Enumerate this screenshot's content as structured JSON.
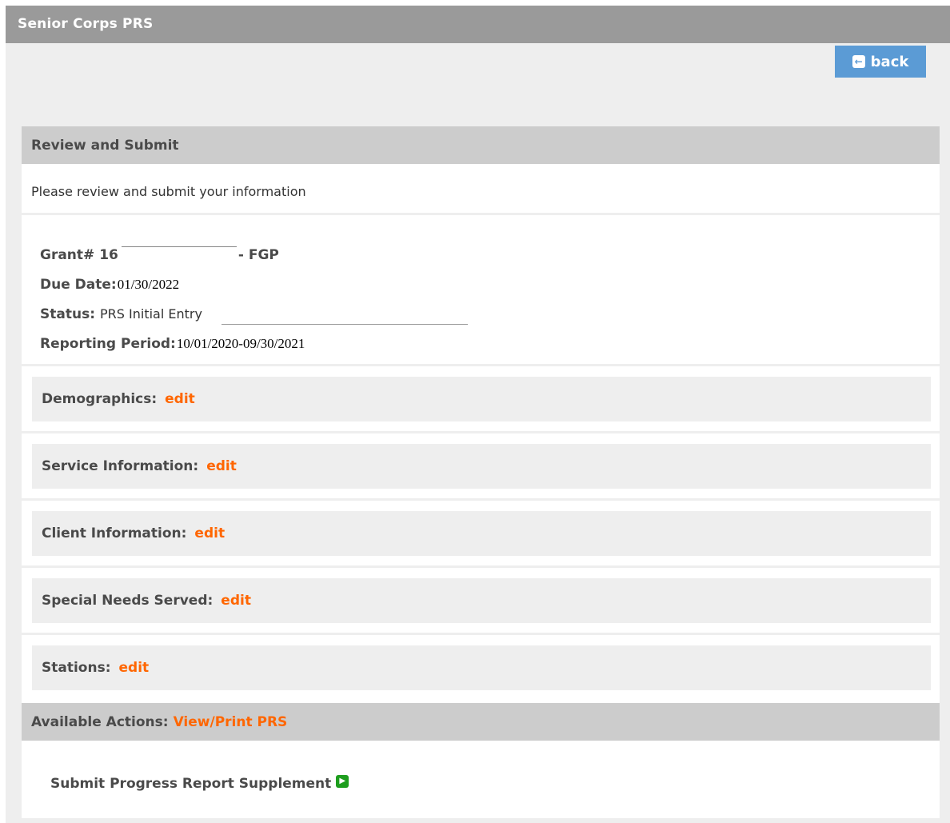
{
  "header": {
    "app_title": "Senior Corps PRS"
  },
  "toolbar": {
    "back_label": "back"
  },
  "review": {
    "title": "Review and Submit",
    "intro": "Please review and submit your information"
  },
  "grant": {
    "grant_label": "Grant# 16",
    "grant_suffix": "- FGP",
    "due_label": "Due Date:",
    "due_value": "01/30/2022",
    "status_label": "Status:",
    "status_value": "PRS Initial Entry",
    "period_label": "Reporting Period:",
    "period_value": "10/01/2020-09/30/2021"
  },
  "sections": [
    {
      "label": "Demographics:",
      "link": "edit"
    },
    {
      "label": "Service Information:",
      "link": "edit"
    },
    {
      "label": "Client Information:",
      "link": "edit"
    },
    {
      "label": "Special Needs Served:",
      "link": "edit"
    },
    {
      "label": "Stations:",
      "link": "edit"
    }
  ],
  "actions": {
    "label": "Available Actions:",
    "link": "View/Print PRS",
    "supplement_label": "Submit Progress Report Supplement"
  }
}
